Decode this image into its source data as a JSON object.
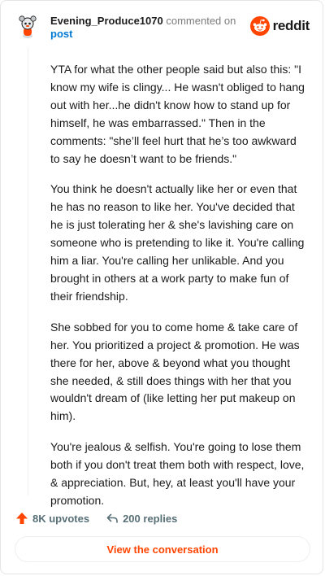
{
  "comment": {
    "username": "Evening_Produce1070",
    "action_text": "commented on",
    "target": "post"
  },
  "brand": {
    "name": "reddit",
    "icon": "reddit-logo-icon",
    "color": "#ff4500"
  },
  "body": {
    "paragraphs": [
      "YTA for what the other people said but also this: \"I know my wife is clingy... He wasn't obliged to hang out with her...he didn't know how to stand up for himself, he was embarrassed.\" Then in the comments: \"she’ll feel hurt that he’s too awkward to say he doesn’t want to be friends.\"",
      "You think he doesn't actually like her or even that he has no reason to like her. You've decided that he is just tolerating her & she's lavishing care on someone who is pretending to like it. You're calling him a liar. You're calling her unlikable. And you brought in others at a work party to make fun of their friendship.",
      "She sobbed for you to come home & take care of her. You prioritized a project & promotion. He was there for her, above & beyond what you thought she needed, & still does things with her that you wouldn't dream of (like letting her put makeup on him).",
      "You're jealous & selfish. You're going to lose them both if you don't treat them both with respect, love, & appreciation. But, hey, at least you'll have your promotion."
    ]
  },
  "stats": {
    "upvotes": "8K upvotes",
    "replies": "200 replies",
    "upvote_icon": "upvote-arrow-icon",
    "reply_icon": "reply-arrow-icon"
  },
  "cta": {
    "label": "View the conversation"
  }
}
